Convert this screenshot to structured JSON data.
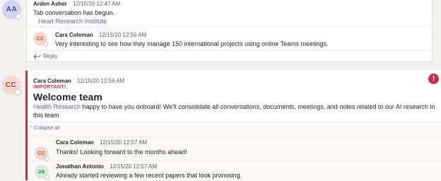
{
  "thread1": {
    "post": {
      "initials": "AA",
      "author": "Arden Asher",
      "timestamp": "12/15/20 12:47 AM",
      "text": "Tab conversation has begun.",
      "link_text": "Heart Research Institute"
    },
    "reply": {
      "initials": "CC",
      "author": "Cara Coleman",
      "timestamp": "12/15/20 12:56 AM",
      "text": "Very interesting to see how they manage 150 international projects using online Teams meetings."
    },
    "reply_label": "Reply"
  },
  "thread2": {
    "post": {
      "initials": "CC",
      "author": "Cara Coleman",
      "timestamp": "12/15/20 12:56 AM",
      "importance": "IMPORTANT!",
      "subject": "Welcome team",
      "mention": "Health Research",
      "text_line1": " happy to have you onboard! We'll consolidate all conversations, documents, meetings, and notes related to our AI research in",
      "text_line2": "this team",
      "alert_icon_text": "!"
    },
    "collapse_label": "Collapse all",
    "replies": [
      {
        "initials": "CC",
        "author": "Cara Coleman",
        "timestamp": "12/15/20 12:57 AM",
        "text": "Thanks! Looking forward to the months ahead!"
      },
      {
        "initials": "JA",
        "author": "Jonathan Antonio",
        "timestamp": "12/15/20 12:57 AM",
        "text": "Already started reviewing a few recent papers that look promising."
      }
    ]
  },
  "colors": {
    "accent": "#6264a7",
    "important": "#c4314b",
    "avatar_aa_bg": "#cfd3ee",
    "avatar_cc_bg": "#f7d7cf",
    "avatar_ja_bg": "#d7ead6"
  }
}
